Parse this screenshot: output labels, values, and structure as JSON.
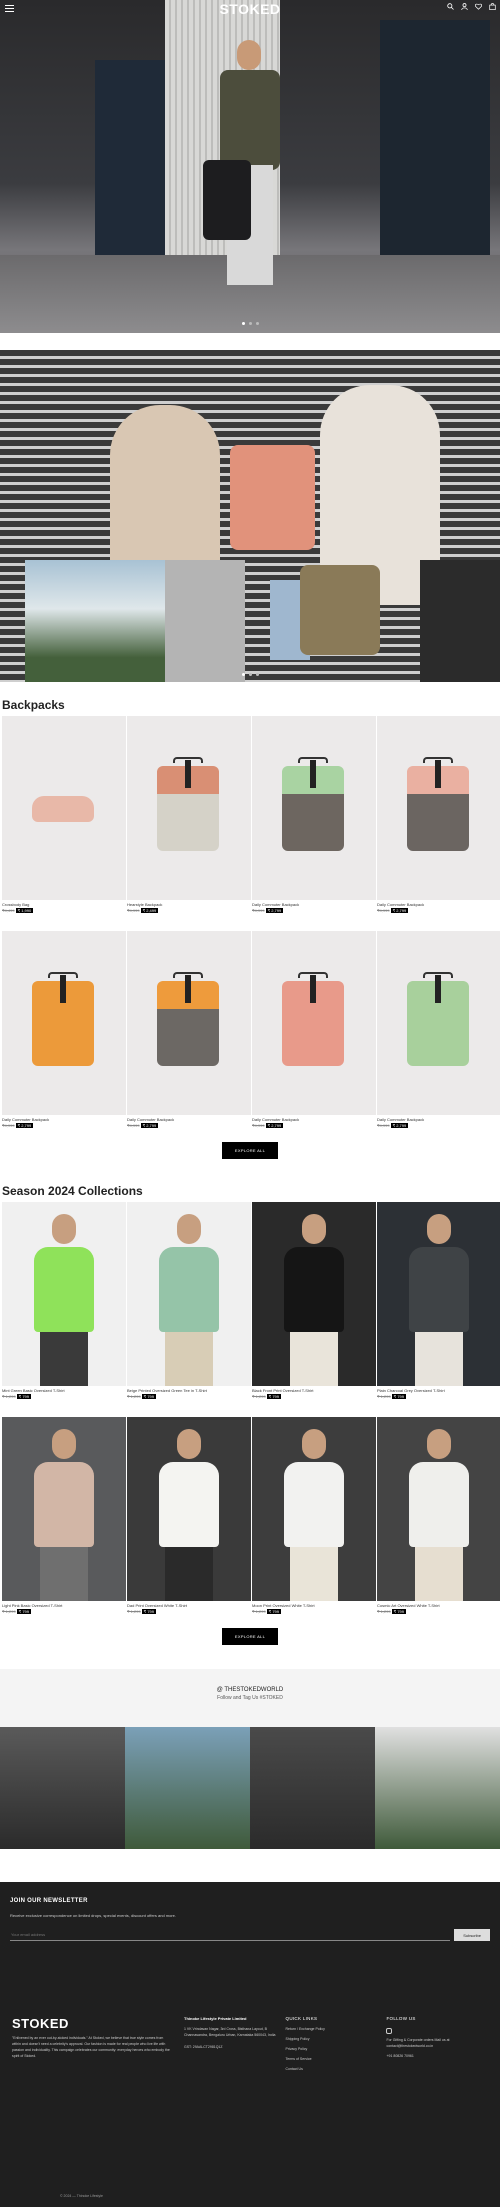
{
  "header": {
    "logo": "STOKED",
    "icons": [
      "search-icon",
      "user-icon",
      "heart-icon",
      "bag-icon"
    ]
  },
  "hero": {
    "slides": 3,
    "active_slide": 1
  },
  "banner": {
    "slides": 3,
    "active_slide": 1
  },
  "backpacks": {
    "title": "Backpacks",
    "button": "EXPLORE ALL",
    "items": [
      {
        "name": "Crossbody Bag",
        "mrp": "₹4,499",
        "price": "₹ 1,990",
        "colors": {
          "top": "#e8b8a8",
          "bottom": "#e8b8a8"
        },
        "sling": true
      },
      {
        "name": "Hearstyle Backpack",
        "mrp": "₹4,999",
        "price": "₹ 2,499",
        "colors": {
          "top": "#d98f74",
          "bottom": "#d5d2c8"
        }
      },
      {
        "name": "Daily Commuter Backpack",
        "mrp": "₹4,999",
        "price": "₹ 2,799",
        "colors": {
          "top": "#a9d3a2",
          "bottom": "#6d6660"
        }
      },
      {
        "name": "Daily Commuter Backpack",
        "mrp": "₹4,999",
        "price": "₹ 2,799",
        "colors": {
          "top": "#eab0a1",
          "bottom": "#6b6561"
        }
      },
      {
        "name": "Daily Commuter Backpack",
        "mrp": "₹4,999",
        "price": "₹ 2,799",
        "colors": {
          "top": "#ec9a3a",
          "bottom": "#ec9a3a"
        }
      },
      {
        "name": "Daily Commuter Backpack",
        "mrp": "₹4,999",
        "price": "₹ 2,799",
        "colors": {
          "top": "#ee9b3c",
          "bottom": "#6c6864"
        }
      },
      {
        "name": "Daily Commuter Backpack",
        "mrp": "₹4,999",
        "price": "₹ 2,799",
        "colors": {
          "top": "#e89a8a",
          "bottom": "#e89a8a"
        }
      },
      {
        "name": "Daily Commuter Backpack",
        "mrp": "₹4,999",
        "price": "₹ 2,799",
        "colors": {
          "top": "#a8d09c",
          "bottom": "#a8d09c"
        }
      }
    ]
  },
  "collections": {
    "title": "Season 2024 Collections",
    "button": "EXPLORE ALL",
    "items": [
      {
        "name": "Mint Green Basic Oversized T-Shirt",
        "mrp": "₹ 1,299",
        "price": "₹ 799",
        "shirt": "#8fe25a",
        "bg": "#f0f0f0",
        "legs": "#3a3a3a"
      },
      {
        "name": "Beige Printed Oversized Green Tee in T-Shirt",
        "mrp": "₹ 1,299",
        "price": "₹ 799",
        "shirt": "#95c4a8",
        "bg": "#f0f0f0",
        "legs": "#d8cdb6"
      },
      {
        "name": "Black Front Print Oversized T-Shirt",
        "mrp": "₹ 1,299",
        "price": "₹ 799",
        "shirt": "#151515",
        "bg": "#2a2a2a",
        "legs": "#e9e4da"
      },
      {
        "name": "Plain Charcoal Grey Oversized T-Shirt",
        "mrp": "₹ 1,299",
        "price": "₹ 799",
        "shirt": "#3f4346",
        "bg": "#2c3035",
        "legs": "#e7e3dc"
      },
      {
        "name": "Light Pink Basic Oversized T-Shirt",
        "mrp": "₹ 1,299",
        "price": "₹ 799",
        "shirt": "#d2b6a6",
        "bg": "#595a5c",
        "legs": "#6f6f6f"
      },
      {
        "name": "Dad Print Oversized White T-Shirt",
        "mrp": "₹ 1,299",
        "price": "₹ 799",
        "shirt": "#f4f4f1",
        "bg": "#3a3a3a",
        "legs": "#2a2a2a"
      },
      {
        "name": "Moon Print Oversized White T-Shirt",
        "mrp": "₹ 1,299",
        "price": "₹ 799",
        "shirt": "#f2f2f0",
        "bg": "#3d3d3d",
        "legs": "#e9e4d8"
      },
      {
        "name": "Cosmic Art Oversized White T-Shirt",
        "mrp": "₹ 1,299",
        "price": "₹ 799",
        "shirt": "#efefec",
        "bg": "#444",
        "legs": "#e6ded0"
      }
    ]
  },
  "instagram": {
    "handle": "@ THESTOKEDWORLD",
    "tagline": "Follow and Tag Us #STOKED",
    "tiles": [
      "#5a5a5a",
      "#7ba0b8",
      "#4a4a4a",
      "#e0e0e0"
    ]
  },
  "newsletter": {
    "title": "JOIN OUR NEWSLETTER",
    "text": "Receive exclusive correspondence on limited drops, special events, discount offers and more.",
    "placeholder": "Your email address",
    "button": "Subscribe"
  },
  "footer": {
    "logo": "STOKED",
    "about": "\"Enlivened by an ever out-by-stoked individuals.\" At Stoked, we believe that true style comes from within and doesn't need a celebrity's approval. Our fashion is made for real people who live life with passion and individuality. This campaign celebrates our community: everyday heroes who embody the spirit of Stoked.",
    "company": "Thinoke Lifestyle Private Limited",
    "address": "1 VK Vrindavan Nagar, 3rd Cross, Bisthana Layout, B Channasandra, Bengaluru Urban, Karnataka 560043, India",
    "gst": "GST: 29AALCT2981Q1Z",
    "links_title": "QUICK LINKS",
    "links": [
      "Return / Exchange Policy",
      "Shipping Policy",
      "Privacy Policy",
      "Terms of Service",
      "Contact Us"
    ],
    "follow_title": "FOLLOW US",
    "follow_text": "For Gifting & Corporate orders Mail us at contact@thestokedworld.co.in",
    "phone": "+91 80826 70961",
    "copyright": "© 2024 — Thinoke Lifestyle"
  },
  "colors": {
    "accent": "#000000",
    "dark_bg": "#1f1f1f"
  }
}
